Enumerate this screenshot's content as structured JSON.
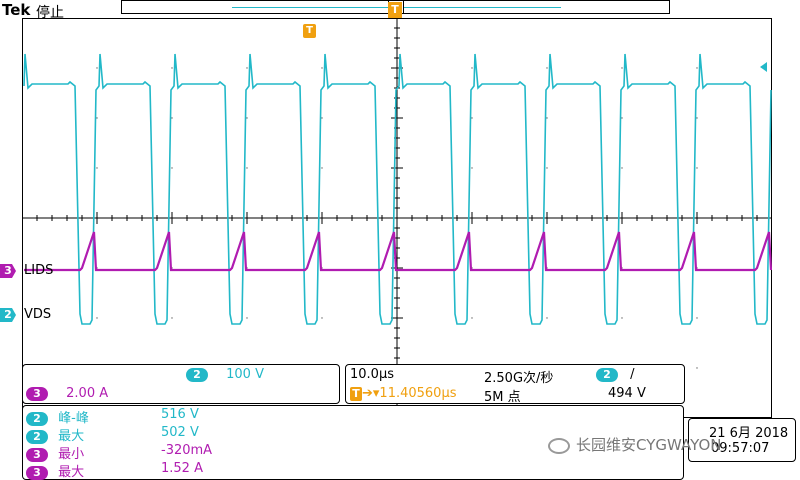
{
  "header": {
    "brand": "Tek",
    "run_state": "停止",
    "trigger_marker": "T",
    "trigger_position_marker": "T"
  },
  "traces": [
    {
      "channel": "3",
      "label": "LIDS",
      "color": "#b01cb0"
    },
    {
      "channel": "2",
      "label": "VDS",
      "color": "#22b8c8"
    }
  ],
  "scale_panel": {
    "ch2_tag": "2",
    "ch2_scale": "100 V",
    "ch3_tag": "3",
    "ch3_scale": "2.00 A"
  },
  "timebase_panel": {
    "time_per_div": "10.0µs",
    "sample_rate": "2.50G次/秒",
    "trigger_tag": "T",
    "trigger_delay": "11.40560µs",
    "record_length": "5M 点",
    "trigger_source_tag": "2",
    "trigger_slope": "/",
    "trigger_level": "494 V"
  },
  "measurements": [
    {
      "channel": "2",
      "name": "峰-峰",
      "value": "516 V"
    },
    {
      "channel": "2",
      "name": "最大",
      "value": "502 V"
    },
    {
      "channel": "3",
      "name": "最小",
      "value": "-320mA"
    },
    {
      "channel": "3",
      "name": "最大",
      "value": "1.52 A"
    }
  ],
  "date_panel": {
    "date": "21 6月 2018",
    "time": "09:57:07"
  },
  "watermark": "长园维安CYGWAYON",
  "colors": {
    "ch2": "#22b8c8",
    "ch3": "#b01cb0",
    "trigger": "#f0a010",
    "graticule": "#000000"
  },
  "waveform": {
    "period_us": 10.0,
    "time_per_div_us": 10.0,
    "vds_high_v": 460,
    "vds_low_v": -20,
    "ids_low_a": 0.0,
    "ids_peak_a": 1.52
  }
}
